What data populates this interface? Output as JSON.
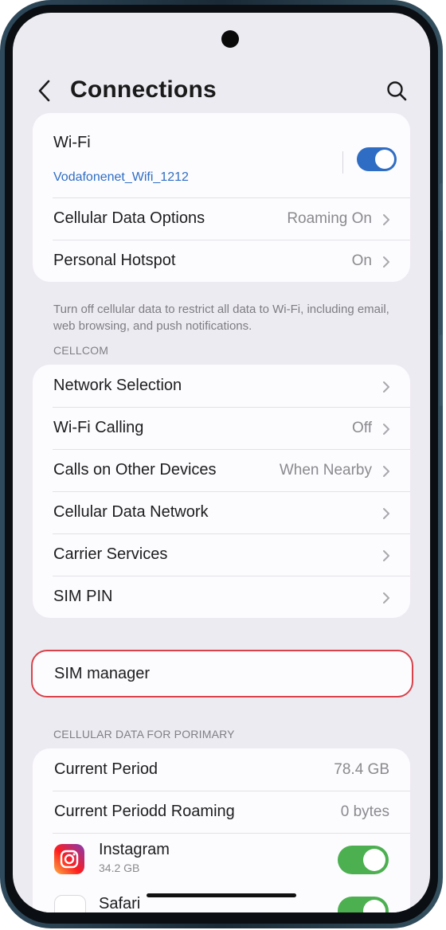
{
  "header": {
    "title": "Connections"
  },
  "wifi": {
    "label": "Wi-Fi",
    "network": "Vodafonenet_Wifi_1212",
    "enabled": true
  },
  "top_rows": [
    {
      "label": "Cellular Data Options",
      "value": "Roaming On"
    },
    {
      "label": "Personal Hotspot",
      "value": "On"
    }
  ],
  "note": "Turn off cellular data to restrict all data to Wi-Fi, including email, web browsing, and push notifications.",
  "carrier": {
    "section_label": "CELLCOM",
    "rows": [
      {
        "label": "Network Selection",
        "value": ""
      },
      {
        "label": "Wi-Fi Calling",
        "value": "Off"
      },
      {
        "label": "Calls on Other Devices",
        "value": "When Nearby"
      },
      {
        "label": "Cellular Data Network",
        "value": ""
      },
      {
        "label": "Carrier Services",
        "value": ""
      },
      {
        "label": "SIM PIN",
        "value": ""
      }
    ]
  },
  "sim_manager": {
    "label": "SIM manager"
  },
  "usage": {
    "section_label": "CELLULAR DATA FOR PORIMARY",
    "rows": [
      {
        "label": "Current Period",
        "value": "78.4 GB"
      },
      {
        "label": "Current Periodd Roaming",
        "value": "0 bytes"
      }
    ],
    "apps": [
      {
        "name": "Instagram",
        "size": "34.2 GB",
        "icon": "instagram-icon",
        "enabled": true
      },
      {
        "name": "Safari",
        "icon": "safari-icon",
        "enabled": true
      }
    ]
  },
  "colors": {
    "accent": "#2f6dc4",
    "toggle_blue": "#2f6dc4",
    "toggle_green": "#4caf50",
    "highlight_red": "#d9424a",
    "screen_bg": "#edebf2",
    "card_bg": "#fcfcfe"
  }
}
